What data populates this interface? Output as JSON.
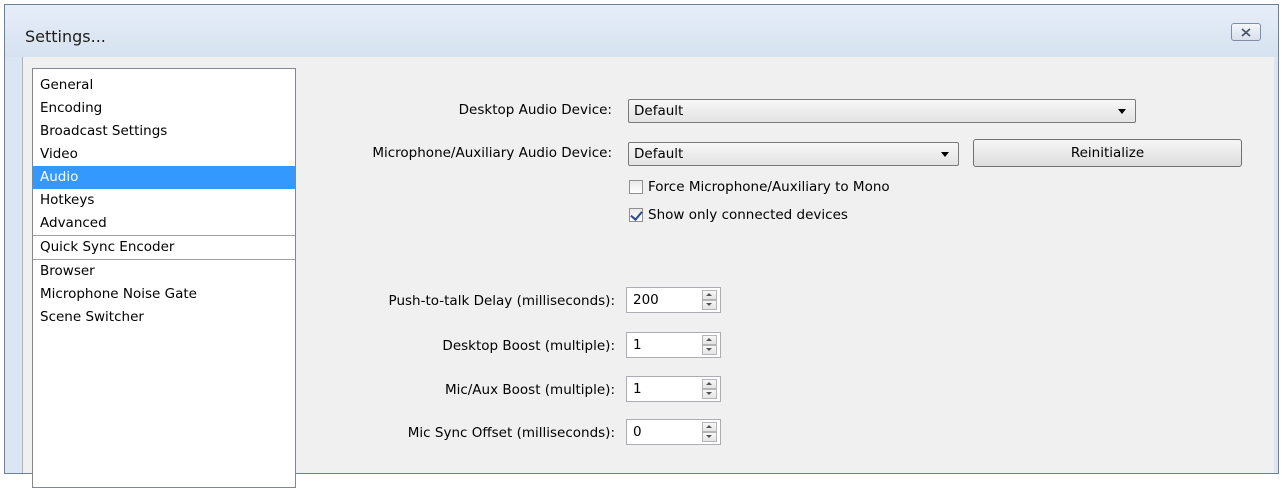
{
  "window": {
    "title": "Settings..."
  },
  "sidebar": {
    "items": [
      {
        "label": "General"
      },
      {
        "label": "Encoding"
      },
      {
        "label": "Broadcast Settings"
      },
      {
        "label": "Video"
      },
      {
        "label": "Audio",
        "selected": true
      },
      {
        "label": "Hotkeys"
      },
      {
        "label": "Advanced"
      },
      {
        "label": "Quick Sync Encoder"
      },
      {
        "label": "Browser"
      },
      {
        "label": "Microphone Noise Gate"
      },
      {
        "label": "Scene Switcher"
      }
    ]
  },
  "audio": {
    "desktop_device": {
      "label": "Desktop Audio Device:",
      "value": "Default"
    },
    "mic_device": {
      "label": "Microphone/Auxiliary Audio Device:",
      "value": "Default"
    },
    "reinitialize_label": "Reinitialize",
    "force_mono": {
      "label": "Force Microphone/Auxiliary to Mono",
      "checked": false
    },
    "show_connected": {
      "label": "Show only connected devices",
      "checked": true
    },
    "push_to_talk_delay": {
      "label": "Push-to-talk Delay (milliseconds):",
      "value": "200"
    },
    "desktop_boost": {
      "label": "Desktop Boost (multiple):",
      "value": "1"
    },
    "mic_boost": {
      "label": "Mic/Aux Boost (multiple):",
      "value": "1"
    },
    "mic_sync_offset": {
      "label": "Mic Sync Offset (milliseconds):",
      "value": "0"
    }
  },
  "icons": {
    "close": "close-icon",
    "dropdown": "chevron-down-icon",
    "spin_up": "arrow-up-icon",
    "spin_down": "arrow-down-icon",
    "check": "check-icon"
  }
}
